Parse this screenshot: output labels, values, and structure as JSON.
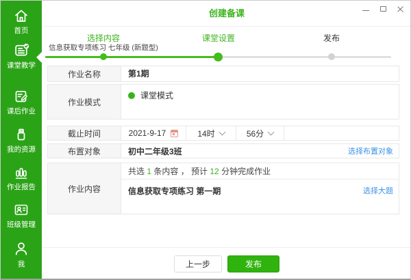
{
  "window": {
    "title": "创建备课",
    "controls": {
      "minimize": "minimize-icon",
      "maximize": "maximize-icon",
      "close": "close-icon"
    }
  },
  "sidebar": {
    "items": [
      {
        "label": "首页",
        "icon": "home-icon",
        "active": false
      },
      {
        "label": "课堂教学",
        "icon": "classroom-teaching-icon",
        "active": true
      },
      {
        "label": "课后作业",
        "icon": "after-class-homework-icon",
        "active": false
      },
      {
        "label": "我的资源",
        "icon": "my-resources-icon",
        "active": false
      },
      {
        "label": "作业报告",
        "icon": "homework-report-icon",
        "active": false
      },
      {
        "label": "班级管理",
        "icon": "class-management-icon",
        "active": false
      },
      {
        "label": "我",
        "icon": "me-icon",
        "active": false
      }
    ]
  },
  "stepper": {
    "steps": [
      {
        "label": "选择内容",
        "subtitle": "信息获取专项练习 七年级 (新题型)",
        "state": "done"
      },
      {
        "label": "课堂设置",
        "subtitle": "",
        "state": "current"
      },
      {
        "label": "发布",
        "subtitle": "",
        "state": "pending"
      }
    ]
  },
  "form": {
    "name_row": {
      "label": "作业名称",
      "value": "第1期"
    },
    "mode_row": {
      "label": "作业模式",
      "option": "课堂模式",
      "selected": true
    },
    "deadline_row": {
      "label": "截止时间",
      "date": "2021-9-17",
      "hour": "14时",
      "minute": "56分"
    },
    "target_row": {
      "label": "布置对象",
      "value": "初中二年级3班",
      "link": "选择布置对象"
    },
    "content_row": {
      "label": "作业内容",
      "summary": {
        "prefix": "共选 ",
        "count": "1",
        "mid": " 条内容 ， 预计 ",
        "minutes": "12",
        "suffix": " 分钟完成作业"
      },
      "item": "信息获取专项练习 第一期",
      "link": "选择大题"
    }
  },
  "footer": {
    "prev": "上一步",
    "publish": "发布"
  },
  "colors": {
    "sidebar_green": "#2ba317",
    "accent_green": "#3db41e",
    "button_green": "#30b30e",
    "link_blue": "#3f92e6",
    "row_border": "#e8e8e8",
    "label_bg": "#f6f6f6"
  }
}
